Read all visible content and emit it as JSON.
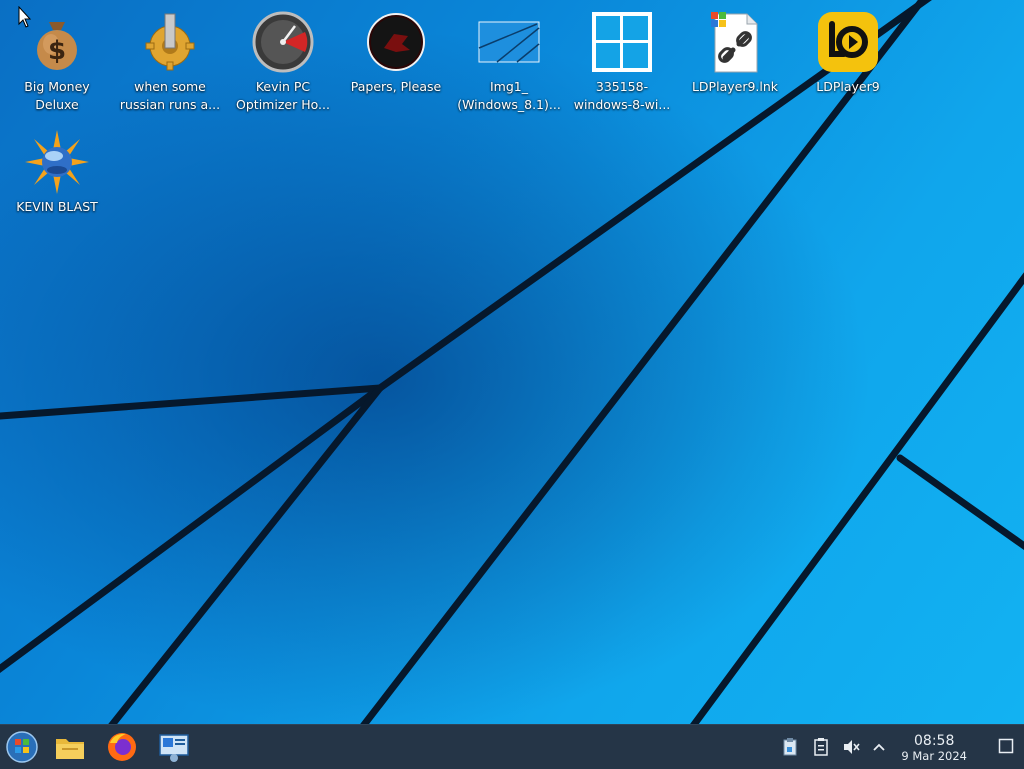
{
  "desktop": {
    "icons": [
      {
        "label": "Big Money\nDeluxe",
        "icon": "money-bag-icon"
      },
      {
        "label": "when some\nrussian runs a...",
        "icon": "gear-icon"
      },
      {
        "label": "Kevin PC\nOptimizer Ho...",
        "icon": "speedometer-icon"
      },
      {
        "label": "Papers, Please",
        "icon": "papers-please-icon"
      },
      {
        "label": "Img1_\n(Windows_8.1)...",
        "icon": "image-file-icon"
      },
      {
        "label": "335158-\nwindows-8-wi...",
        "icon": "windows-logo-icon"
      },
      {
        "label": "LDPlayer9.lnk",
        "icon": "shortcut-link-icon"
      },
      {
        "label": "LDPlayer9",
        "icon": "ldplayer-icon"
      },
      {
        "label": "KEVIN BLAST",
        "icon": "blast-globe-icon"
      }
    ]
  },
  "taskbar": {
    "pinned": [
      {
        "icon": "start-orb-icon"
      },
      {
        "icon": "file-explorer-icon"
      },
      {
        "icon": "firefox-icon"
      },
      {
        "icon": "remote-desktop-icon"
      }
    ],
    "tray": [
      {
        "icon": "clipboard-tray-icon"
      },
      {
        "icon": "notes-tray-icon"
      },
      {
        "icon": "volume-muted-icon"
      },
      {
        "icon": "chevron-up-icon"
      }
    ],
    "clock": {
      "time": "08:58",
      "date": "9 Mar 2024"
    }
  },
  "colors": {
    "taskbar": "#253547",
    "wallpaper_accent": "#0b84d9",
    "ldplayer_yellow": "#f4c20d"
  }
}
